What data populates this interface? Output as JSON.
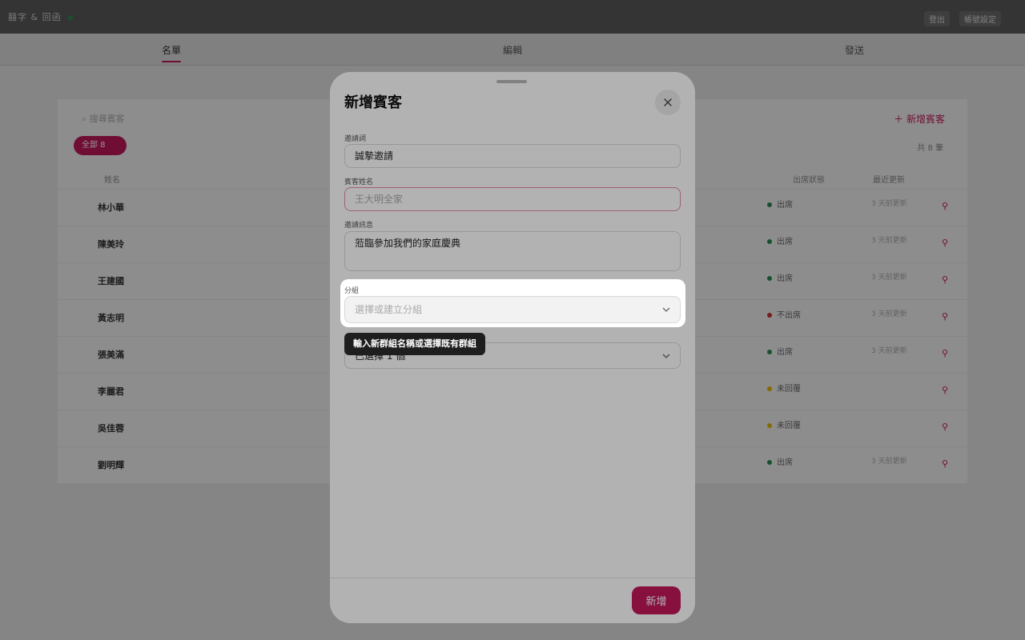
{
  "app": {
    "title": "囍字 & 回函"
  },
  "topbar": {
    "buttons": [
      "登出",
      "帳號設定"
    ]
  },
  "tabs": [
    {
      "label": "名單",
      "active": true
    },
    {
      "label": "編輯",
      "active": false
    },
    {
      "label": "發送",
      "active": false
    }
  ],
  "guest_list": {
    "search_placeholder": "搜尋賓客",
    "filter_chip": "全部 8",
    "add_button": "新增賓客",
    "count_label": "共 8 筆",
    "columns": [
      "姓名",
      "出席狀態",
      "最近更新"
    ],
    "rows": [
      {
        "name": "林小華",
        "status": "出席",
        "status_color": "#2e8b57",
        "updated": "3 天前更新"
      },
      {
        "name": "陳美玲",
        "status": "出席",
        "status_color": "#2e8b57",
        "updated": "3 天前更新"
      },
      {
        "name": "王建國",
        "status": "出席",
        "status_color": "#2e8b57",
        "updated": "3 天前更新"
      },
      {
        "name": "黃志明",
        "status": "不出席",
        "status_color": "#d32f2f",
        "updated": "3 天前更新"
      },
      {
        "name": "張美滿",
        "status": "出席",
        "status_color": "#2e8b57",
        "updated": "3 天前更新"
      },
      {
        "name": "李麗君",
        "status": "未回覆",
        "status_color": "#e6b800",
        "updated": ""
      },
      {
        "name": "吳佳蓉",
        "status": "未回覆",
        "status_color": "#e6b800",
        "updated": ""
      },
      {
        "name": "劉明輝",
        "status": "出席",
        "status_color": "#2e8b57",
        "updated": "3 天前更新"
      }
    ]
  },
  "modal": {
    "title": "新增賓客",
    "close_icon": "close-icon",
    "invitation_label": "邀請詞",
    "invitation_value": "誠摯邀請",
    "guest_name_label": "賓客姓名",
    "guest_name_placeholder": "王大明全家",
    "message_label": "邀請訊息",
    "message_value": "蒞臨參加我們的家庭慶典",
    "group_label": "分組",
    "group_placeholder": "選擇或建立分組",
    "hidden_field_value": "已選擇 1 個",
    "submit_label": "新增"
  },
  "tooltip": {
    "text": "輸入新群組名稱或選擇既有群組"
  },
  "colors": {
    "accent": "#c2185b",
    "attending": "#2e8b57",
    "declined": "#d32f2f",
    "pending": "#e6b800"
  }
}
